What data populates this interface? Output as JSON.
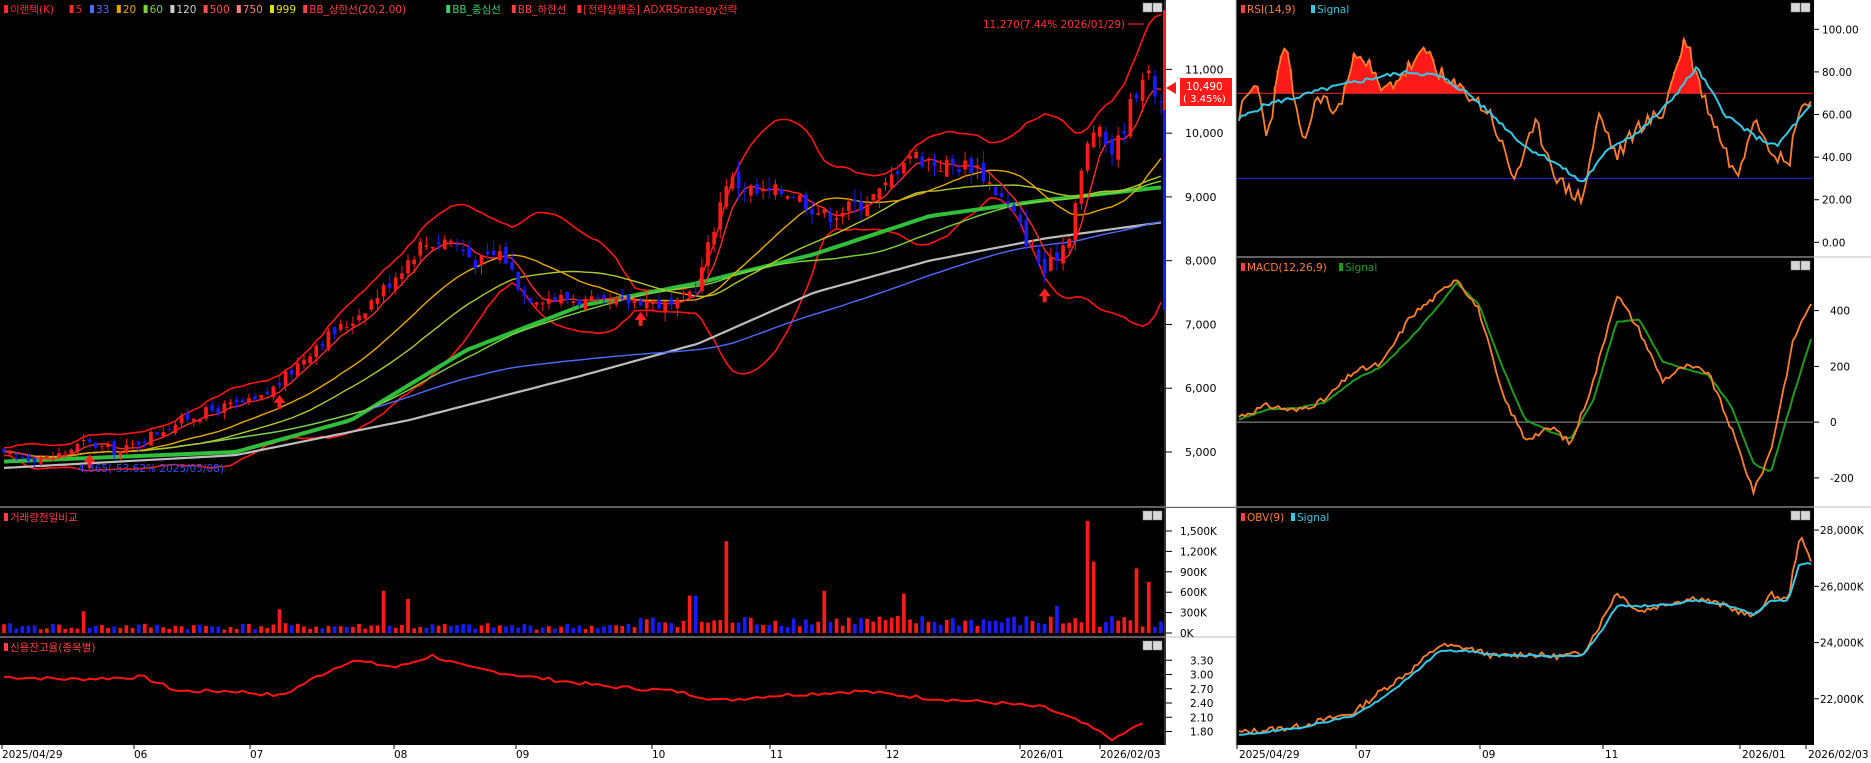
{
  "colors": {
    "background": "#000000",
    "axis_bg": "#ffffff",
    "candle_up": "#ff1a1a",
    "candle_down": "#1a1aff",
    "ma5": "#ff2a2a",
    "ma20": "#e6a800",
    "ma60": "#7cd33f",
    "ma120": "#4e6bff",
    "ma500": "#2fbf3a",
    "ma750": "#bdbdbd",
    "bollinger": "#ff1414",
    "rsi": "#ff7f2a",
    "rsi_signal": "#36c8e6",
    "macd": "#ff7f2a",
    "macd_signal": "#1e9b1e",
    "obv": "#ff7f2a",
    "obv_signal": "#36c8e6",
    "credit": "#ff1414",
    "threshold_high": "#ff2a2a",
    "threshold_low": "#2222ff"
  },
  "icons": {
    "panel_menu": "panel-menu-icon",
    "panel_close": "panel-close-icon",
    "buy_arrow": "up-arrow-icon",
    "price_pointer": "left-triangle-icon"
  },
  "price_panel": {
    "legend": [
      "이랜텍(K)",
      "5",
      "33",
      "20",
      "60",
      "120",
      "500",
      "750",
      "999",
      "BB_상한선(20,2.00)",
      "BB_중심선",
      "BB_하한선",
      "[전략실행중] ADXRStrategy전략"
    ],
    "high_annotation": "11,270(7.44% 2026/01/29)",
    "low_annotation": "4,865(-53.62% 2025/05/08)",
    "current_price": "10,490",
    "current_change": "( 3.45%)"
  },
  "volume_panel": {
    "legend": "거래량전일비교"
  },
  "credit_panel": {
    "legend": "신용잔고율(종목별)"
  },
  "rsi_panel": {
    "legend_main": "RSI(14,9)",
    "legend_signal": "Signal"
  },
  "macd_panel": {
    "legend_main": "MACD(12,26,9)",
    "legend_signal": "Signal"
  },
  "obv_panel": {
    "legend_main": "OBV(9)",
    "legend_signal": "Signal"
  },
  "main_xaxis": [
    "2025/04/29",
    "06",
    "07",
    "08",
    "09",
    "10",
    "11",
    "12",
    "2026/01",
    "2026/02/03"
  ],
  "right_xaxis": [
    "2025/04/29",
    "07",
    "09",
    "11",
    "2026/01",
    "2026/02/03"
  ],
  "chart_data": [
    {
      "type": "candlestick",
      "title": "이랜텍(K)",
      "x_range": [
        "2025/04/29",
        "2026/02/03"
      ],
      "ylim": [
        4200,
        11900
      ],
      "yticks": [
        "11,000",
        "10,000",
        "9,000",
        "8,000",
        "7,000",
        "6,000",
        "5,000"
      ],
      "ytick_values": [
        11000,
        10000,
        9000,
        8000,
        7000,
        6000,
        5000
      ],
      "close_anchors": [
        {
          "t": 0.0,
          "v": 4950
        },
        {
          "t": 0.04,
          "v": 4900
        },
        {
          "t": 0.07,
          "v": 5150
        },
        {
          "t": 0.1,
          "v": 5000
        },
        {
          "t": 0.13,
          "v": 5300
        },
        {
          "t": 0.16,
          "v": 5550
        },
        {
          "t": 0.19,
          "v": 5700
        },
        {
          "t": 0.22,
          "v": 5800
        },
        {
          "t": 0.245,
          "v": 6200
        },
        {
          "t": 0.27,
          "v": 6700
        },
        {
          "t": 0.3,
          "v": 7050
        },
        {
          "t": 0.33,
          "v": 7600
        },
        {
          "t": 0.36,
          "v": 8250
        },
        {
          "t": 0.385,
          "v": 8350
        },
        {
          "t": 0.41,
          "v": 7950
        },
        {
          "t": 0.43,
          "v": 8150
        },
        {
          "t": 0.45,
          "v": 7450
        },
        {
          "t": 0.49,
          "v": 7400
        },
        {
          "t": 0.52,
          "v": 7300
        },
        {
          "t": 0.55,
          "v": 7400
        },
        {
          "t": 0.58,
          "v": 7250
        },
        {
          "t": 0.6,
          "v": 7650
        },
        {
          "t": 0.625,
          "v": 9300
        },
        {
          "t": 0.65,
          "v": 9050
        },
        {
          "t": 0.68,
          "v": 9100
        },
        {
          "t": 0.71,
          "v": 8700
        },
        {
          "t": 0.74,
          "v": 8900
        },
        {
          "t": 0.76,
          "v": 9100
        },
        {
          "t": 0.78,
          "v": 9700
        },
        {
          "t": 0.81,
          "v": 9500
        },
        {
          "t": 0.84,
          "v": 9500
        },
        {
          "t": 0.87,
          "v": 8800
        },
        {
          "t": 0.9,
          "v": 7800
        },
        {
          "t": 0.92,
          "v": 8400
        },
        {
          "t": 0.94,
          "v": 10100
        },
        {
          "t": 0.96,
          "v": 9700
        },
        {
          "t": 0.975,
          "v": 10500
        },
        {
          "t": 0.985,
          "v": 11000
        },
        {
          "t": 1.0,
          "v": 10490
        }
      ],
      "ma_series": [
        {
          "name": "5",
          "period": 5,
          "color": "#ff2a2a"
        },
        {
          "name": "20",
          "period": 20,
          "color": "#e6a800"
        },
        {
          "name": "33",
          "period": 33,
          "color": "#b0c830"
        },
        {
          "name": "60",
          "period": 60,
          "color": "#7cd33f"
        },
        {
          "name": "120",
          "period": 120,
          "color": "#4e6bff"
        }
      ],
      "ma_500": [
        {
          "t": 0,
          "v": 4850
        },
        {
          "t": 0.2,
          "v": 5000
        },
        {
          "t": 0.3,
          "v": 5500
        },
        {
          "t": 0.4,
          "v": 6600
        },
        {
          "t": 0.5,
          "v": 7300
        },
        {
          "t": 0.6,
          "v": 7650
        },
        {
          "t": 0.7,
          "v": 8100
        },
        {
          "t": 0.8,
          "v": 8700
        },
        {
          "t": 0.9,
          "v": 8950
        },
        {
          "t": 1.0,
          "v": 9150
        }
      ],
      "ma_750": [
        {
          "t": 0,
          "v": 4750
        },
        {
          "t": 0.2,
          "v": 4950
        },
        {
          "t": 0.35,
          "v": 5500
        },
        {
          "t": 0.5,
          "v": 6200
        },
        {
          "t": 0.6,
          "v": 6700
        },
        {
          "t": 0.7,
          "v": 7500
        },
        {
          "t": 0.8,
          "v": 8000
        },
        {
          "t": 0.9,
          "v": 8350
        },
        {
          "t": 1.0,
          "v": 8600
        }
      ],
      "bollinger_period": 20,
      "bollinger_k": 2,
      "buy_markers_t": [
        0.075,
        0.24,
        0.55,
        0.9
      ],
      "sell_markers_t": [
        0.06
      ]
    },
    {
      "type": "bar",
      "title": "거래량전일비교",
      "ylim": [
        0,
        1750000
      ],
      "yticks": [
        "1,500K",
        "1,200K",
        "900K",
        "600K",
        "300K",
        "0K"
      ],
      "ytick_values": [
        1500000,
        1200000,
        900000,
        600000,
        300000,
        0
      ],
      "spikes": [
        {
          "t": 0.07,
          "v": 320000
        },
        {
          "t": 0.24,
          "v": 350000
        },
        {
          "t": 0.33,
          "v": 620000
        },
        {
          "t": 0.35,
          "v": 500000
        },
        {
          "t": 0.595,
          "v": 550000
        },
        {
          "t": 0.625,
          "v": 1350000
        },
        {
          "t": 0.71,
          "v": 620000
        },
        {
          "t": 0.78,
          "v": 580000
        },
        {
          "t": 0.91,
          "v": 400000
        },
        {
          "t": 0.935,
          "v": 1650000
        },
        {
          "t": 0.94,
          "v": 1050000
        },
        {
          "t": 0.98,
          "v": 950000
        },
        {
          "t": 0.99,
          "v": 750000
        }
      ],
      "base_level": 80000
    },
    {
      "type": "line",
      "title": "신용잔고율(종목별)",
      "ylim": [
        1.6,
        3.6
      ],
      "yticks": [
        "3.30",
        "3.00",
        "2.70",
        "2.40",
        "2.10",
        "1.80"
      ],
      "ytick_values": [
        3.3,
        3.0,
        2.7,
        2.4,
        2.1,
        1.8
      ],
      "points": [
        {
          "t": 0,
          "v": 2.95
        },
        {
          "t": 0.06,
          "v": 2.9
        },
        {
          "t": 0.12,
          "v": 2.95
        },
        {
          "t": 0.15,
          "v": 2.65
        },
        {
          "t": 0.2,
          "v": 2.65
        },
        {
          "t": 0.24,
          "v": 2.55
        },
        {
          "t": 0.27,
          "v": 2.95
        },
        {
          "t": 0.3,
          "v": 3.3
        },
        {
          "t": 0.34,
          "v": 3.15
        },
        {
          "t": 0.37,
          "v": 3.4
        },
        {
          "t": 0.4,
          "v": 3.15
        },
        {
          "t": 0.44,
          "v": 3.0
        },
        {
          "t": 0.47,
          "v": 2.9
        },
        {
          "t": 0.52,
          "v": 2.75
        },
        {
          "t": 0.58,
          "v": 2.65
        },
        {
          "t": 0.62,
          "v": 2.45
        },
        {
          "t": 0.66,
          "v": 2.55
        },
        {
          "t": 0.7,
          "v": 2.6
        },
        {
          "t": 0.74,
          "v": 2.65
        },
        {
          "t": 0.8,
          "v": 2.5
        },
        {
          "t": 0.86,
          "v": 2.4
        },
        {
          "t": 0.9,
          "v": 2.3
        },
        {
          "t": 0.93,
          "v": 2.0
        },
        {
          "t": 0.96,
          "v": 1.62
        },
        {
          "t": 0.98,
          "v": 1.95
        }
      ]
    },
    {
      "type": "line",
      "title": "RSI(14,9)",
      "ylim": [
        -5,
        110
      ],
      "yticks": [
        "100.00",
        "80.00",
        "60.00",
        "40.00",
        "20.00",
        "0.00"
      ],
      "ytick_values": [
        100,
        80,
        60,
        40,
        20,
        0
      ],
      "overbought": 70,
      "oversold": 30,
      "rsi": [
        {
          "t": 0,
          "v": 60
        },
        {
          "t": 0.03,
          "v": 75
        },
        {
          "t": 0.05,
          "v": 50
        },
        {
          "t": 0.08,
          "v": 95
        },
        {
          "t": 0.11,
          "v": 45
        },
        {
          "t": 0.14,
          "v": 70
        },
        {
          "t": 0.17,
          "v": 60
        },
        {
          "t": 0.21,
          "v": 92
        },
        {
          "t": 0.25,
          "v": 70
        },
        {
          "t": 0.29,
          "v": 80
        },
        {
          "t": 0.33,
          "v": 90
        },
        {
          "t": 0.36,
          "v": 75
        },
        {
          "t": 0.4,
          "v": 70
        },
        {
          "t": 0.44,
          "v": 60
        },
        {
          "t": 0.48,
          "v": 30
        },
        {
          "t": 0.52,
          "v": 55
        },
        {
          "t": 0.56,
          "v": 28
        },
        {
          "t": 0.6,
          "v": 20
        },
        {
          "t": 0.63,
          "v": 60
        },
        {
          "t": 0.66,
          "v": 40
        },
        {
          "t": 0.7,
          "v": 55
        },
        {
          "t": 0.74,
          "v": 60
        },
        {
          "t": 0.78,
          "v": 96
        },
        {
          "t": 0.81,
          "v": 70
        },
        {
          "t": 0.84,
          "v": 50
        },
        {
          "t": 0.87,
          "v": 30
        },
        {
          "t": 0.9,
          "v": 60
        },
        {
          "t": 0.93,
          "v": 45
        },
        {
          "t": 0.96,
          "v": 35
        },
        {
          "t": 0.98,
          "v": 65
        },
        {
          "t": 1.0,
          "v": 65
        }
      ],
      "signal": [
        {
          "t": 0,
          "v": 58
        },
        {
          "t": 0.05,
          "v": 65
        },
        {
          "t": 0.1,
          "v": 68
        },
        {
          "t": 0.15,
          "v": 72
        },
        {
          "t": 0.2,
          "v": 75
        },
        {
          "t": 0.25,
          "v": 78
        },
        {
          "t": 0.3,
          "v": 80
        },
        {
          "t": 0.35,
          "v": 78
        },
        {
          "t": 0.4,
          "v": 70
        },
        {
          "t": 0.45,
          "v": 58
        },
        {
          "t": 0.5,
          "v": 45
        },
        {
          "t": 0.55,
          "v": 38
        },
        {
          "t": 0.6,
          "v": 28
        },
        {
          "t": 0.65,
          "v": 45
        },
        {
          "t": 0.7,
          "v": 52
        },
        {
          "t": 0.75,
          "v": 65
        },
        {
          "t": 0.8,
          "v": 82
        },
        {
          "t": 0.85,
          "v": 60
        },
        {
          "t": 0.9,
          "v": 50
        },
        {
          "t": 0.94,
          "v": 45
        },
        {
          "t": 0.97,
          "v": 55
        },
        {
          "t": 1.0,
          "v": 64
        }
      ]
    },
    {
      "type": "line",
      "title": "MACD(12,26,9)",
      "ylim": [
        -290,
        560
      ],
      "yticks": [
        "400",
        "200",
        "0",
        "-200"
      ],
      "ytick_values": [
        400,
        200,
        0,
        -200
      ],
      "macd": [
        {
          "t": 0,
          "v": 20
        },
        {
          "t": 0.05,
          "v": 60
        },
        {
          "t": 0.1,
          "v": 40
        },
        {
          "t": 0.15,
          "v": 80
        },
        {
          "t": 0.2,
          "v": 180
        },
        {
          "t": 0.25,
          "v": 210
        },
        {
          "t": 0.3,
          "v": 380
        },
        {
          "t": 0.35,
          "v": 460
        },
        {
          "t": 0.38,
          "v": 520
        },
        {
          "t": 0.42,
          "v": 400
        },
        {
          "t": 0.46,
          "v": 100
        },
        {
          "t": 0.5,
          "v": -60
        },
        {
          "t": 0.55,
          "v": -20
        },
        {
          "t": 0.58,
          "v": -80
        },
        {
          "t": 0.62,
          "v": 150
        },
        {
          "t": 0.66,
          "v": 460
        },
        {
          "t": 0.7,
          "v": 330
        },
        {
          "t": 0.74,
          "v": 150
        },
        {
          "t": 0.78,
          "v": 200
        },
        {
          "t": 0.82,
          "v": 180
        },
        {
          "t": 0.86,
          "v": -20
        },
        {
          "t": 0.9,
          "v": -250
        },
        {
          "t": 0.93,
          "v": -100
        },
        {
          "t": 0.97,
          "v": 300
        },
        {
          "t": 1.0,
          "v": 430
        }
      ],
      "signal": [
        {
          "t": 0,
          "v": 10
        },
        {
          "t": 0.05,
          "v": 45
        },
        {
          "t": 0.1,
          "v": 50
        },
        {
          "t": 0.15,
          "v": 70
        },
        {
          "t": 0.2,
          "v": 150
        },
        {
          "t": 0.25,
          "v": 200
        },
        {
          "t": 0.3,
          "v": 300
        },
        {
          "t": 0.35,
          "v": 420
        },
        {
          "t": 0.38,
          "v": 500
        },
        {
          "t": 0.42,
          "v": 420
        },
        {
          "t": 0.46,
          "v": 200
        },
        {
          "t": 0.5,
          "v": 10
        },
        {
          "t": 0.55,
          "v": -40
        },
        {
          "t": 0.58,
          "v": -60
        },
        {
          "t": 0.62,
          "v": 80
        },
        {
          "t": 0.66,
          "v": 360
        },
        {
          "t": 0.7,
          "v": 370
        },
        {
          "t": 0.74,
          "v": 220
        },
        {
          "t": 0.78,
          "v": 190
        },
        {
          "t": 0.82,
          "v": 170
        },
        {
          "t": 0.86,
          "v": 60
        },
        {
          "t": 0.9,
          "v": -150
        },
        {
          "t": 0.93,
          "v": -180
        },
        {
          "t": 0.97,
          "v": 100
        },
        {
          "t": 1.0,
          "v": 300
        }
      ]
    },
    {
      "type": "line",
      "title": "OBV(9)",
      "ylim": [
        20500,
        28500
      ],
      "yticks": [
        "28,000K",
        "26,000K",
        "24,000K",
        "22,000K"
      ],
      "ytick_values": [
        28000,
        26000,
        24000,
        22000
      ],
      "obv": [
        {
          "t": 0,
          "v": 20800
        },
        {
          "t": 0.1,
          "v": 21000
        },
        {
          "t": 0.2,
          "v": 21500
        },
        {
          "t": 0.25,
          "v": 22300
        },
        {
          "t": 0.3,
          "v": 23000
        },
        {
          "t": 0.35,
          "v": 23900
        },
        {
          "t": 0.4,
          "v": 23800
        },
        {
          "t": 0.45,
          "v": 23500
        },
        {
          "t": 0.5,
          "v": 23600
        },
        {
          "t": 0.55,
          "v": 23500
        },
        {
          "t": 0.6,
          "v": 23600
        },
        {
          "t": 0.63,
          "v": 24600
        },
        {
          "t": 0.66,
          "v": 25800
        },
        {
          "t": 0.7,
          "v": 25100
        },
        {
          "t": 0.75,
          "v": 25400
        },
        {
          "t": 0.8,
          "v": 25600
        },
        {
          "t": 0.85,
          "v": 25300
        },
        {
          "t": 0.9,
          "v": 24900
        },
        {
          "t": 0.93,
          "v": 25700
        },
        {
          "t": 0.96,
          "v": 25500
        },
        {
          "t": 0.98,
          "v": 27800
        },
        {
          "t": 1.0,
          "v": 26900
        }
      ],
      "signal": [
        {
          "t": 0,
          "v": 20700
        },
        {
          "t": 0.1,
          "v": 20950
        },
        {
          "t": 0.2,
          "v": 21400
        },
        {
          "t": 0.25,
          "v": 22000
        },
        {
          "t": 0.3,
          "v": 22800
        },
        {
          "t": 0.35,
          "v": 23700
        },
        {
          "t": 0.4,
          "v": 23700
        },
        {
          "t": 0.45,
          "v": 23550
        },
        {
          "t": 0.5,
          "v": 23550
        },
        {
          "t": 0.55,
          "v": 23500
        },
        {
          "t": 0.6,
          "v": 23550
        },
        {
          "t": 0.63,
          "v": 24300
        },
        {
          "t": 0.66,
          "v": 25300
        },
        {
          "t": 0.7,
          "v": 25300
        },
        {
          "t": 0.75,
          "v": 25350
        },
        {
          "t": 0.8,
          "v": 25500
        },
        {
          "t": 0.85,
          "v": 25350
        },
        {
          "t": 0.9,
          "v": 25000
        },
        {
          "t": 0.93,
          "v": 25500
        },
        {
          "t": 0.96,
          "v": 25500
        },
        {
          "t": 0.98,
          "v": 26800
        },
        {
          "t": 1.0,
          "v": 26800
        }
      ]
    }
  ]
}
